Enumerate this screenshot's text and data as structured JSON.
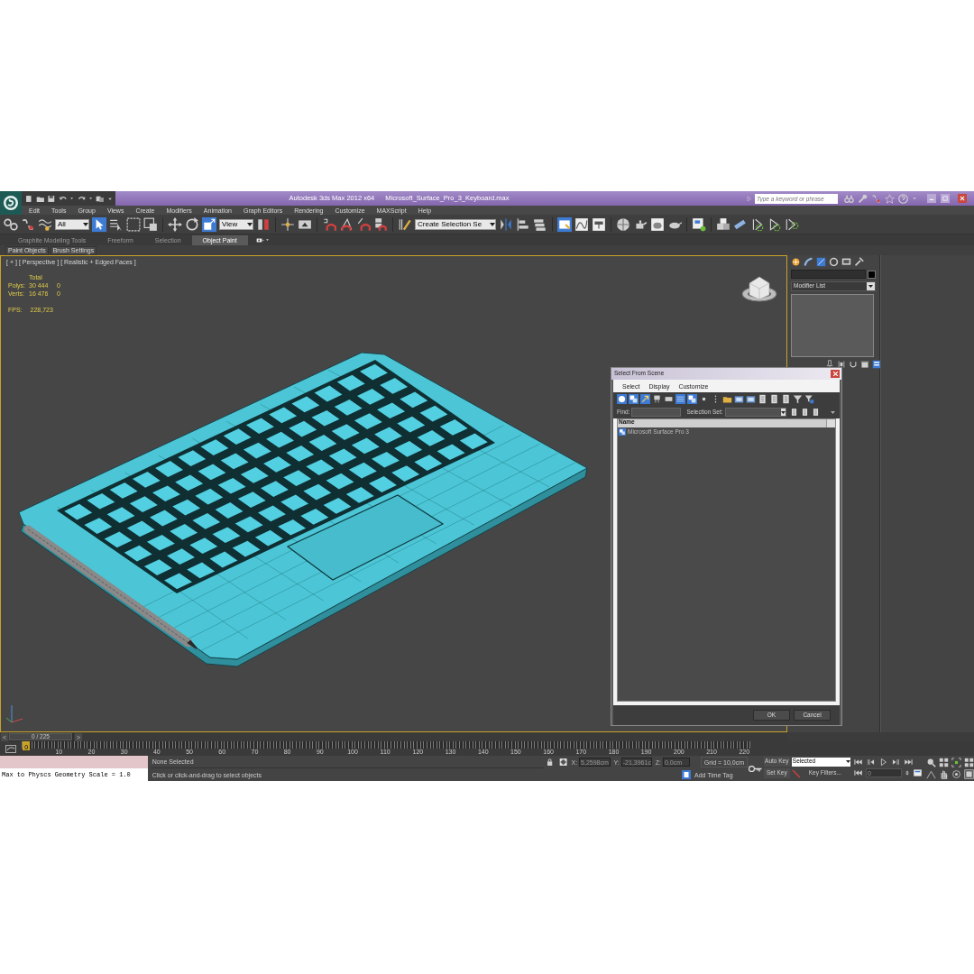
{
  "title_bar": {
    "app_title": "Autodesk 3ds Max  2012 x64",
    "file_name": "Microsoft_Surface_Pro_3_Keyboard.max",
    "search": {
      "placeholder": "Type a keyword or phrase"
    }
  },
  "menu_bar": [
    "Edit",
    "Tools",
    "Group",
    "Views",
    "Create",
    "Modifiers",
    "Animation",
    "Graph Editors",
    "Rendering",
    "Customize",
    "MAXScript",
    "Help"
  ],
  "main_toolbar": {
    "selection_filter": "All",
    "reference_coordinate_system": "View",
    "named_selection_set": "Create Selection Se"
  },
  "ribbon": {
    "tabs": [
      {
        "label": "Graphite Modeling Tools",
        "selected": false
      },
      {
        "label": "Freeform",
        "selected": false
      },
      {
        "label": "Selection",
        "selected": false
      },
      {
        "label": "Object Paint",
        "selected": true
      }
    ],
    "panels": [
      "Paint Objects",
      "Brush Settings"
    ]
  },
  "viewport": {
    "labels": [
      "[ + ]",
      "[ Perspective ]",
      "[ Realistic + Edged Faces ]"
    ],
    "statistics": {
      "header": "Total",
      "rows": [
        {
          "label": "Polys:",
          "total": "30 444",
          "in_selection": "0"
        },
        {
          "label": "Verts:",
          "total": "16 476",
          "in_selection": "0"
        }
      ]
    },
    "fps": {
      "label": "FPS:",
      "value": "228,723"
    }
  },
  "command_panel": {
    "modifier_list": "Modifier List"
  },
  "select_dialog": {
    "title": "Select From Scene",
    "menu": [
      "Select",
      "Display",
      "Customize"
    ],
    "find_label": "Find:",
    "selection_set_label": "Selection Set:",
    "columns": [
      "Name"
    ],
    "rows": [
      "Microsoft Surface Pro 3"
    ],
    "buttons": [
      "OK",
      "Cancel"
    ]
  },
  "time_slider": {
    "previous": "<",
    "position": "0 / 225",
    "next": ">"
  },
  "track_bar": {
    "current_frame": "0",
    "ticks": [
      "10",
      "20",
      "30",
      "40",
      "50",
      "60",
      "70",
      "80",
      "90",
      "100",
      "110",
      "120",
      "130",
      "140",
      "150",
      "160",
      "170",
      "180",
      "190",
      "200",
      "210",
      "220"
    ]
  },
  "status_bar": {
    "listener_output": "Max to Physcs Geometry Scale = 1.0",
    "selection": "None Selected",
    "prompt": "Click or click-and-drag to select objects",
    "x": {
      "label": "X:",
      "value": "5,2598cm"
    },
    "y": {
      "label": "Y:",
      "value": "-21,3961c"
    },
    "z": {
      "label": "Z:",
      "value": "0,0cm"
    },
    "grid": "Grid = 10,0cm",
    "add_time_tag": "Add Time Tag",
    "auto_key": "Auto Key",
    "key_mode": "Selected",
    "set_key": "Set Key",
    "key_filters": "Key Filters...",
    "frame": "0"
  }
}
